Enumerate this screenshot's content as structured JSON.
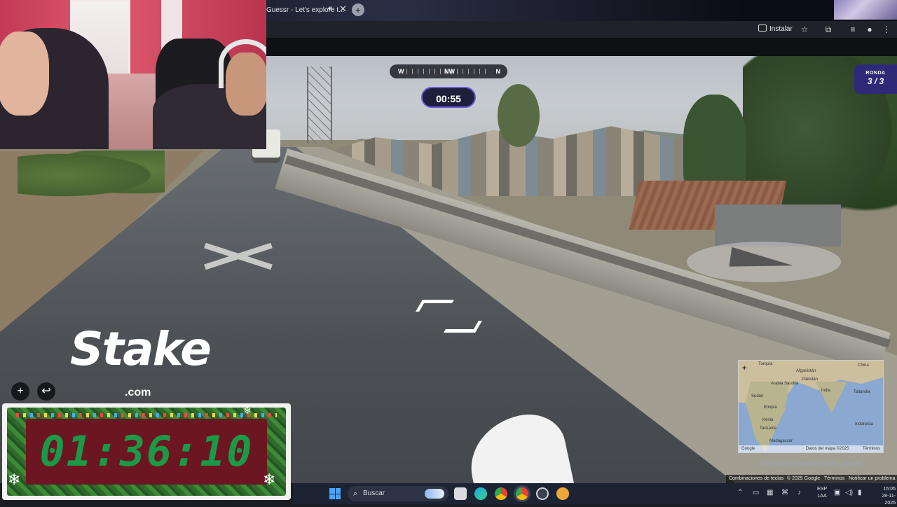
{
  "browser": {
    "tab_title": "Guessr - Let's explore t...",
    "install_label": "Instalar"
  },
  "compass": {
    "left": "W",
    "center": "NW",
    "right": "N"
  },
  "game": {
    "timer": "00:55",
    "round_label": "RONDA",
    "round_value": "3 / 3"
  },
  "overlay": {
    "countdown": "01:36:10"
  },
  "zoom": {
    "in": "+",
    "back": "↩"
  },
  "minimap": {
    "zoom_in": "+",
    "labels": [
      "Turquía",
      "Afganistán",
      "China",
      "Pakistán",
      "Arabia Saudita",
      "India",
      "Sudán",
      "Etiopía",
      "Kenia",
      "Tanzania",
      "Tailandia",
      "Indonesia",
      "Madagascar"
    ],
    "footer_left": "Google",
    "footer_mid": "Datos del mapa ©2025",
    "footer_right": "Términos",
    "place_pin": "COLOCA TU CHINCHETA EN EL MAPA"
  },
  "google_footer": {
    "shortcuts": "Combinaciones de teclas",
    "copyright": "© 2025 Google",
    "terms": "Términos",
    "report": "Notificar un problema"
  },
  "taskbar": {
    "search_placeholder": "Buscar",
    "lang_1": "ESP",
    "lang_2": "LAA",
    "time": "15:05",
    "date": "28-11-2025"
  },
  "colors": {
    "round_badge": "#2e2a78",
    "timer_border": "#6a5ad8",
    "countdown_digits": "#1a9a48",
    "countdown_panel": "#6b1620"
  }
}
